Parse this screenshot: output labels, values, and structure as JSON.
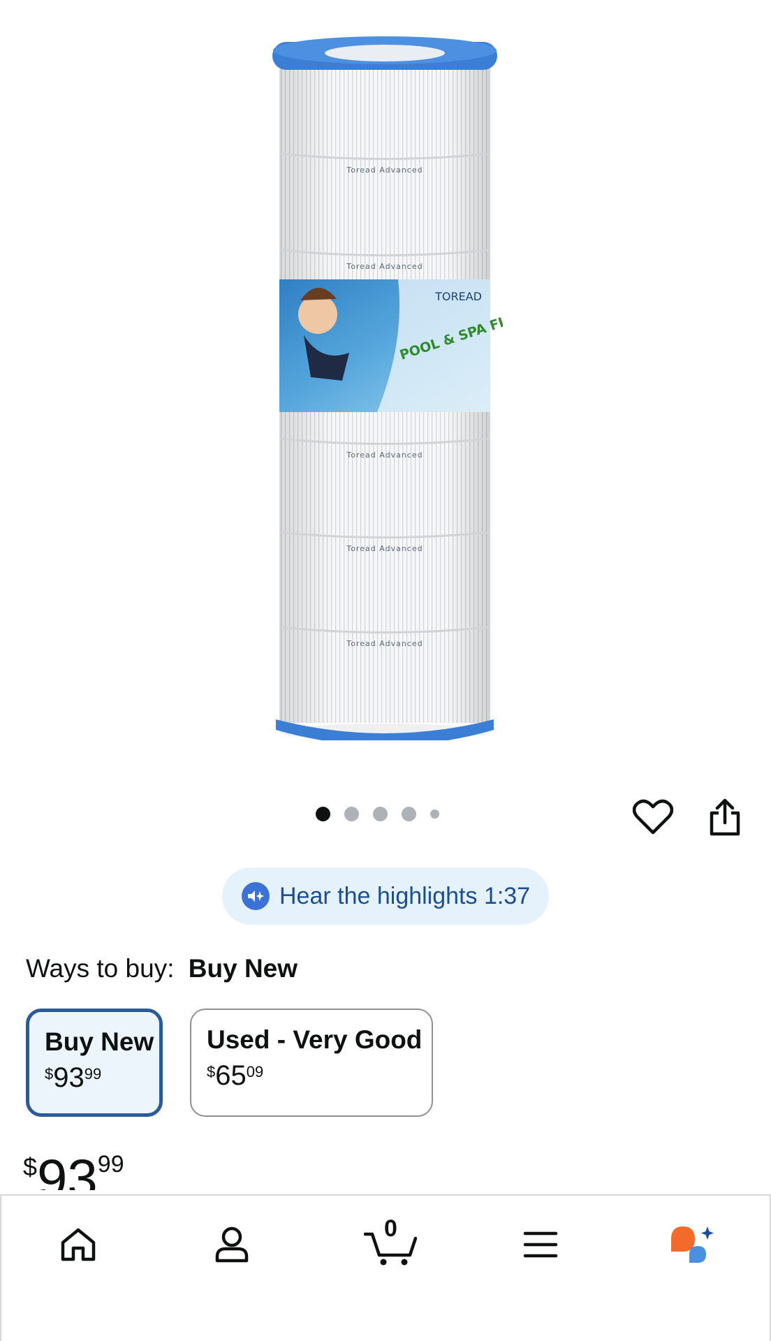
{
  "product": {
    "image_alt": "Toread pool and spa filter cartridge",
    "image_band_text": "Toread Advanced",
    "label_brand": "TOREAD",
    "label_title": "POOL & SPA FILTER"
  },
  "carousel": {
    "count": 5,
    "active_index": 0
  },
  "actions": {
    "wishlist": "heart-icon",
    "share": "share-icon"
  },
  "highlights": {
    "label": "Hear the highlights 1:37"
  },
  "ways_to_buy": {
    "prefix": "Ways to buy:",
    "selected": "Buy New",
    "options": [
      {
        "title": "Buy New",
        "currency": "$",
        "whole": "93",
        "fraction": "99"
      },
      {
        "title": "Used - Very Good",
        "currency": "$",
        "whole": "65",
        "fraction": "09"
      }
    ]
  },
  "price": {
    "currency": "$",
    "whole": "93",
    "fraction": "99"
  },
  "bottom_nav": {
    "items": [
      "home-icon",
      "account-icon",
      "cart-icon",
      "menu-icon",
      "assistant-icon"
    ],
    "cart_count": "0"
  },
  "colors": {
    "filter_cap": "#3a7fd5",
    "selected_border": "#2a5a99",
    "pill_bg": "#e5f2fb",
    "assistant_orange": "#f26b2a",
    "assistant_blue": "#4a90e2"
  }
}
